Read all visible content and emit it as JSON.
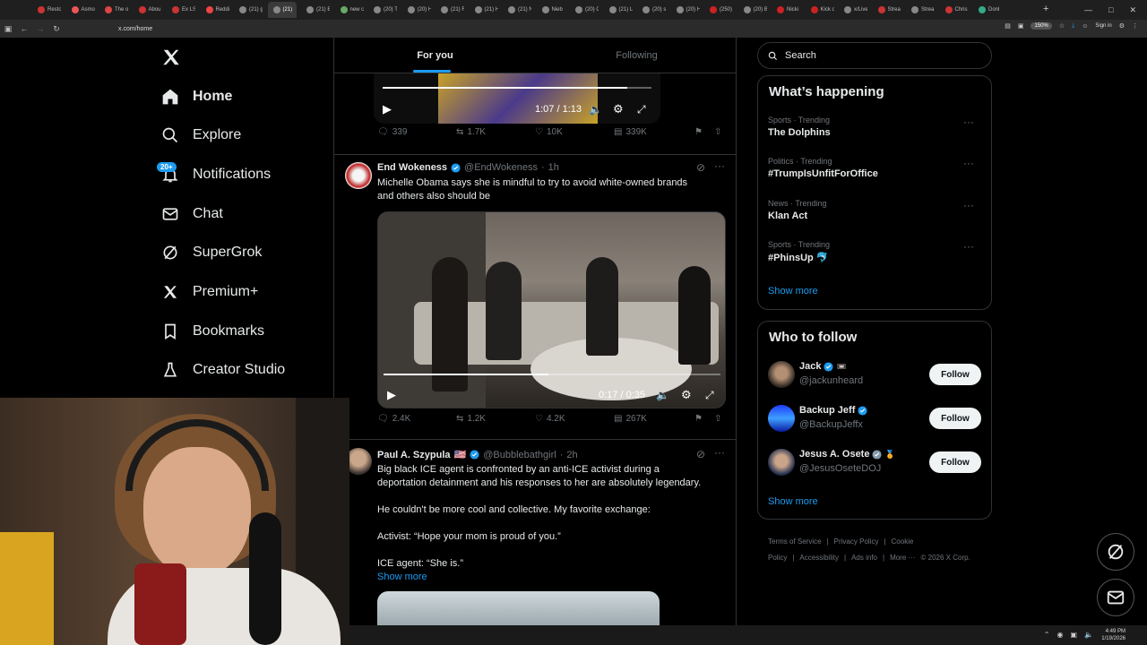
{
  "browser": {
    "tabs": [
      "Resto",
      "Asmo",
      "The o",
      "Abou",
      "Ex LS",
      "Reddi",
      "(21) g",
      "(21)",
      "(21) E",
      "new c",
      "(20) T",
      "(20) H",
      "(21) F",
      "(21) H",
      "(21) N",
      "Nieb",
      "(20) C",
      "(21) L",
      "(20) s",
      "(20) H",
      "(250)",
      "(20) B",
      "Nicki",
      "Kick o",
      "x/Live",
      "Strea",
      "Strea",
      "Chris",
      "Donl"
    ],
    "url": "x.com/home",
    "zoom": "150%",
    "signin": "Sign in",
    "new_tab": "+"
  },
  "nav": {
    "badge": "20+",
    "items": [
      {
        "label": "Home",
        "icon": "home-icon"
      },
      {
        "label": "Explore",
        "icon": "search-icon"
      },
      {
        "label": "Notifications",
        "icon": "bell-icon"
      },
      {
        "label": "Chat",
        "icon": "mail-icon"
      },
      {
        "label": "SuperGrok",
        "icon": "grok-icon"
      },
      {
        "label": "Premium+",
        "icon": "x-logo-icon"
      },
      {
        "label": "Bookmarks",
        "icon": "bookmark-icon"
      },
      {
        "label": "Creator Studio",
        "icon": "flask-icon"
      }
    ]
  },
  "feed_tabs": {
    "for_you": "For you",
    "following": "Following"
  },
  "post1": {
    "video_time": "1:07 / 1:13",
    "progress": 0.91,
    "replies": "339",
    "reposts": "1.7K",
    "likes": "10K",
    "views": "339K"
  },
  "post2": {
    "name": "End Wokeness",
    "handle": "@EndWokeness",
    "time": "1h",
    "text_line1": "Michelle Obama says she is mindful to try to avoid white-owned brands",
    "text_line2": "and others also should be",
    "video_time": "0:17 / 0:35",
    "progress": 0.49,
    "replies": "2.4K",
    "reposts": "1.2K",
    "likes": "4.2K",
    "views": "267K"
  },
  "post3": {
    "name": "Paul A. Szypula",
    "flag": "🇺🇸",
    "handle": "@Bubblebathgirl",
    "time": "2h",
    "line1": "Big black ICE agent is confronted by an anti-ICE activist during a",
    "line2": "deportation detainment and his responses to her are absolutely legendary.",
    "line3": "He couldn't be more cool and collective. My favorite exchange:",
    "line4": "Activist: “Hope your mom is proud of you.”",
    "line5": "ICE agent: “She is.”",
    "show_more": "Show more"
  },
  "search": {
    "placeholder": "Search"
  },
  "happening": {
    "title": "What’s happening",
    "trends": [
      {
        "category": "Sports · Trending",
        "topic": "The Dolphins"
      },
      {
        "category": "Politics · Trending",
        "topic": "#TrumpIsUnfitForOffice"
      },
      {
        "category": "News · Trending",
        "topic": "Klan Act"
      },
      {
        "category": "Sports · Trending",
        "topic": "#PhinsUp 🐬"
      }
    ],
    "show_more": "Show more"
  },
  "who_to_follow": {
    "title": "Who to follow",
    "users": [
      {
        "name": "Jack",
        "handle": "@jackunheard",
        "extra": "📼"
      },
      {
        "name": "Backup Jeff",
        "handle": "@BackupJeffx",
        "extra": ""
      },
      {
        "name": "Jesus A. Osete",
        "handle": "@JesusOseteDOJ",
        "extra": "🏅"
      }
    ],
    "follow_label": "Follow",
    "show_more": "Show more"
  },
  "footer": {
    "links": [
      "Terms of Service",
      "|",
      "Privacy Policy",
      "|",
      "Cookie Policy",
      "|",
      "Accessibility",
      "|",
      "Ads info",
      "|",
      "More ···",
      "© 2026 X Corp."
    ]
  },
  "taskbar": {
    "time": "4:49 PM",
    "date": "1/19/2026"
  },
  "colors": {
    "accent": "#1d9bf0",
    "bg": "#000000",
    "border": "#2f3336",
    "muted": "#71767b"
  }
}
